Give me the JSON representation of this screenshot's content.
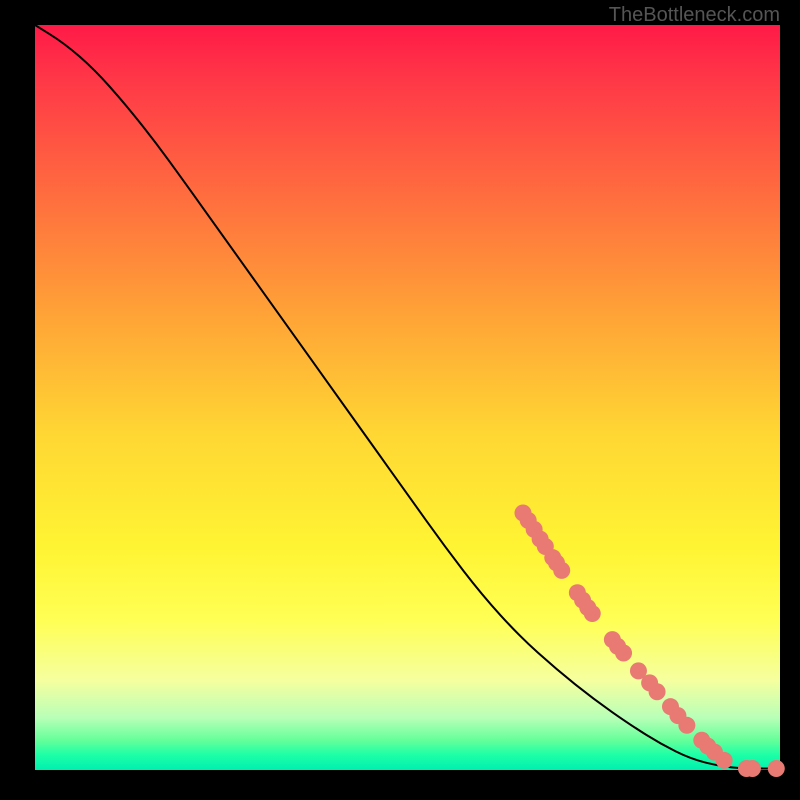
{
  "attribution": "TheBottleneck.com",
  "colors": {
    "point_fill": "#e87a73",
    "line": "#000000"
  },
  "chart_data": {
    "type": "line",
    "title": "",
    "xlabel": "",
    "ylabel": "",
    "xlim": [
      0,
      100
    ],
    "ylim": [
      0,
      100
    ],
    "grid": false,
    "curve": [
      {
        "x": 0.0,
        "y": 100.0
      },
      {
        "x": 4.0,
        "y": 97.5
      },
      {
        "x": 8.0,
        "y": 94.0
      },
      {
        "x": 12.0,
        "y": 89.5
      },
      {
        "x": 16.0,
        "y": 84.5
      },
      {
        "x": 20.0,
        "y": 79.0
      },
      {
        "x": 25.0,
        "y": 72.0
      },
      {
        "x": 30.0,
        "y": 65.0
      },
      {
        "x": 35.0,
        "y": 58.0
      },
      {
        "x": 40.0,
        "y": 51.0
      },
      {
        "x": 45.0,
        "y": 44.0
      },
      {
        "x": 50.0,
        "y": 37.0
      },
      {
        "x": 55.0,
        "y": 30.0
      },
      {
        "x": 60.0,
        "y": 23.5
      },
      {
        "x": 65.0,
        "y": 18.0
      },
      {
        "x": 70.0,
        "y": 13.5
      },
      {
        "x": 75.0,
        "y": 9.5
      },
      {
        "x": 80.0,
        "y": 6.0
      },
      {
        "x": 84.0,
        "y": 3.5
      },
      {
        "x": 88.0,
        "y": 1.5
      },
      {
        "x": 92.0,
        "y": 0.5
      },
      {
        "x": 95.0,
        "y": 0.2
      },
      {
        "x": 100.0,
        "y": 0.2
      }
    ],
    "points": [
      {
        "x": 65.5,
        "y": 34.5
      },
      {
        "x": 66.2,
        "y": 33.5
      },
      {
        "x": 67.0,
        "y": 32.3
      },
      {
        "x": 67.8,
        "y": 31.0
      },
      {
        "x": 68.5,
        "y": 30.0
      },
      {
        "x": 69.5,
        "y": 28.5
      },
      {
        "x": 70.0,
        "y": 27.8
      },
      {
        "x": 70.7,
        "y": 26.8
      },
      {
        "x": 72.8,
        "y": 23.8
      },
      {
        "x": 73.5,
        "y": 22.8
      },
      {
        "x": 74.2,
        "y": 21.8
      },
      {
        "x": 74.8,
        "y": 21.0
      },
      {
        "x": 77.5,
        "y": 17.5
      },
      {
        "x": 78.2,
        "y": 16.6
      },
      {
        "x": 79.0,
        "y": 15.7
      },
      {
        "x": 81.0,
        "y": 13.3
      },
      {
        "x": 82.5,
        "y": 11.7
      },
      {
        "x": 83.5,
        "y": 10.5
      },
      {
        "x": 85.3,
        "y": 8.5
      },
      {
        "x": 86.3,
        "y": 7.3
      },
      {
        "x": 87.5,
        "y": 6.0
      },
      {
        "x": 89.5,
        "y": 4.0
      },
      {
        "x": 90.3,
        "y": 3.2
      },
      {
        "x": 91.2,
        "y": 2.4
      },
      {
        "x": 92.5,
        "y": 1.3
      },
      {
        "x": 95.5,
        "y": 0.2
      },
      {
        "x": 96.3,
        "y": 0.2
      },
      {
        "x": 99.5,
        "y": 0.2
      }
    ]
  }
}
